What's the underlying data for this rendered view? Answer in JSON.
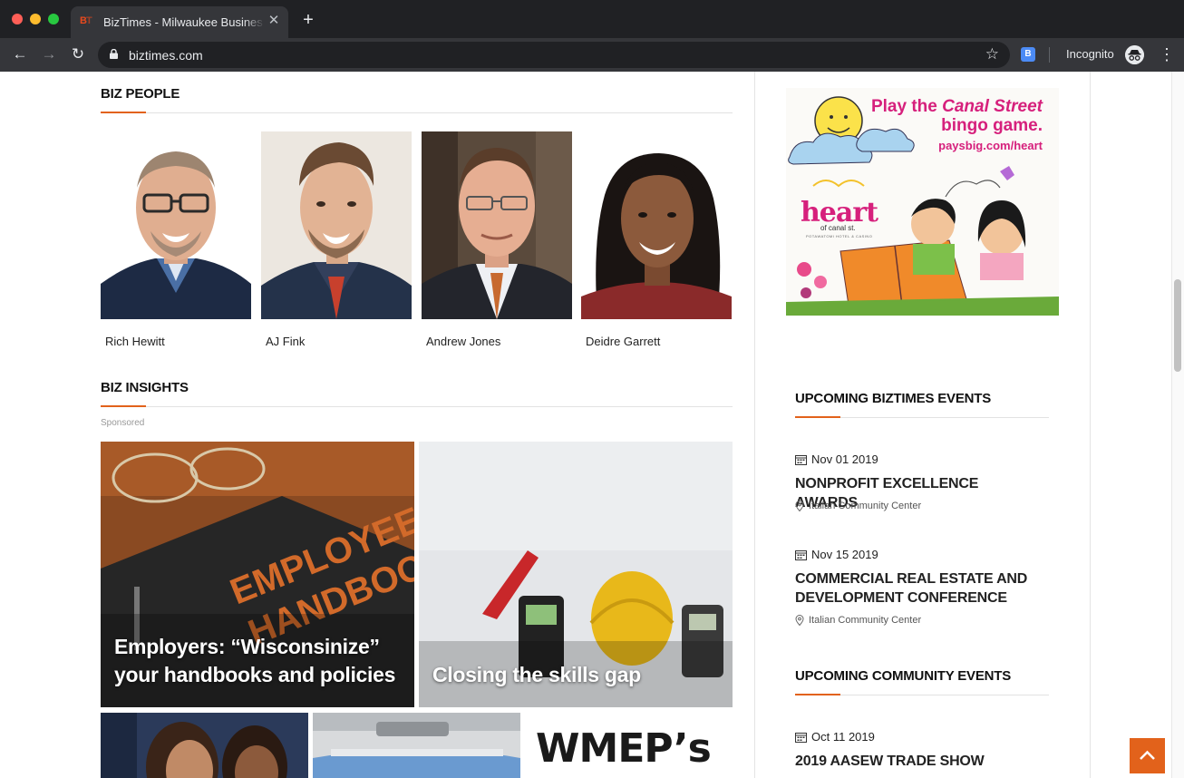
{
  "browser": {
    "tab_favicon_b": "B",
    "tab_favicon_t": "T",
    "tab_title": "BizTimes - Milwaukee Business",
    "tab_close": "✕",
    "new_tab": "+",
    "back": "←",
    "forward": "→",
    "reload": "↻",
    "url": "biztimes.com",
    "star": "☆",
    "extension_label": "B",
    "incognito_label": "Incognito",
    "menu": "⋮"
  },
  "biz_people": {
    "heading": "BIZ PEOPLE",
    "people": [
      {
        "name": "Rich Hewitt"
      },
      {
        "name": "AJ Fink"
      },
      {
        "name": "Andrew Jones"
      },
      {
        "name": "Deidre Garrett"
      }
    ]
  },
  "biz_insights": {
    "heading": "BIZ INSIGHTS",
    "sponsored": "Sponsored",
    "cards": [
      {
        "title": "Employers: “Wisconsinize” your handbooks and policies",
        "image_text_1": "EMPLOYEE",
        "image_text_2": "HANDBOOK"
      },
      {
        "title": "Closing the skills gap"
      }
    ],
    "bottom_cards": [
      {
        "image_text": ""
      },
      {
        "image_text": ""
      },
      {
        "image_text": "WMEP’s"
      }
    ]
  },
  "ad": {
    "line1_prefix": "Play the ",
    "line1_emph": "Canal Street",
    "line2": "bingo game.",
    "url": "paysbig.com/heart",
    "brand": "heart",
    "brand_sub": "of canal st.",
    "brand_sub2": "POTAWATOMI HOTEL & CASINO"
  },
  "upcoming_biztimes_events": {
    "heading": "UPCOMING BIZTIMES EVENTS",
    "events": [
      {
        "date": "Nov 01 2019",
        "title": "NONPROFIT EXCELLENCE AWARDS",
        "venue": "Italian Community Center"
      },
      {
        "date": "Nov 15 2019",
        "title": "COMMERCIAL REAL ESTATE AND DEVELOPMENT CONFERENCE",
        "venue": "Italian Community Center"
      }
    ]
  },
  "upcoming_community_events": {
    "heading": "UPCOMING COMMUNITY EVENTS",
    "events": [
      {
        "date": "Oct 11 2019",
        "title": "2019 AASEW TRADE SHOW"
      }
    ]
  },
  "colors": {
    "accent": "#e2621b",
    "ad_pink": "#d6207c",
    "chrome_dark": "#202124",
    "chrome_mid": "#35363a"
  },
  "icons": {
    "calendar": "calendar-icon",
    "map_pin": "map-pin-icon",
    "back_to_top": "chevron-up-icon"
  }
}
